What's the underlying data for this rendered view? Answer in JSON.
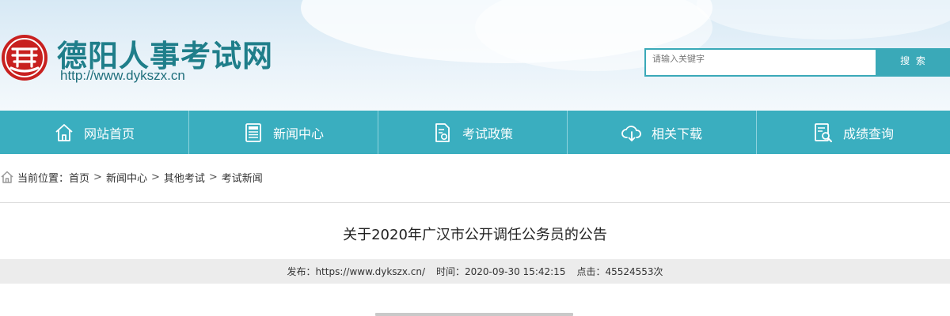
{
  "header": {
    "site_title": "德阳人事考试网",
    "site_url": "http://www.dykszx.cn",
    "search": {
      "placeholder": "请输入关键字",
      "button_label": "搜 索"
    },
    "colors": {
      "accent": "#3aa9b8",
      "logo_red": "#c8201f",
      "title": "#1f7e8a"
    }
  },
  "nav": {
    "items": [
      {
        "label": "网站首页",
        "icon": "home-icon"
      },
      {
        "label": "新闻中心",
        "icon": "news-icon"
      },
      {
        "label": "考试政策",
        "icon": "policy-icon"
      },
      {
        "label": "相关下载",
        "icon": "cloud-download-icon"
      },
      {
        "label": "成绩查询",
        "icon": "search-results-icon"
      }
    ]
  },
  "breadcrumb": {
    "prefix": "当前位置：",
    "items": [
      "首页",
      "新闻中心",
      "其他考试",
      "考试新闻"
    ],
    "separator": ">"
  },
  "article": {
    "title": "关于2020年广汉市公开调任公务员的公告",
    "meta": {
      "publisher": "发布：https://www.dykszx.cn/",
      "time": "时间：2020-09-30 15:42:15",
      "clicks": "点击：45524553次"
    }
  }
}
